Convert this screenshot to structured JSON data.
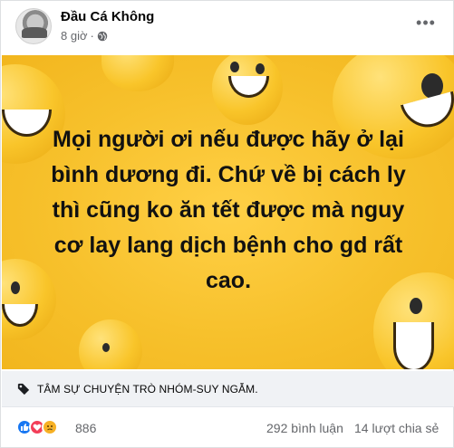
{
  "post": {
    "author": "Đầu Cá Không",
    "time": "8 giờ",
    "privacy_icon": "globe-icon",
    "more_label": "•••",
    "text": "Mọi người ơi nếu được hãy ở lại bình dương đi. Chứ về bị cách ly thì cũng ko ăn tết được mà nguy cơ lay lang dịch bệnh cho gd rất cao.",
    "background_color": "#f7c12c"
  },
  "tag": {
    "icon": "tag-icon",
    "label": "TÂM SỰ CHUYỆN TRÒ NHÓM-SUY NGẪM."
  },
  "stats": {
    "reaction_icons": [
      "like-icon",
      "love-icon",
      "sad-icon"
    ],
    "reaction_count": "886",
    "comments": "292 bình luận",
    "shares": "14 lượt chia sẻ"
  }
}
